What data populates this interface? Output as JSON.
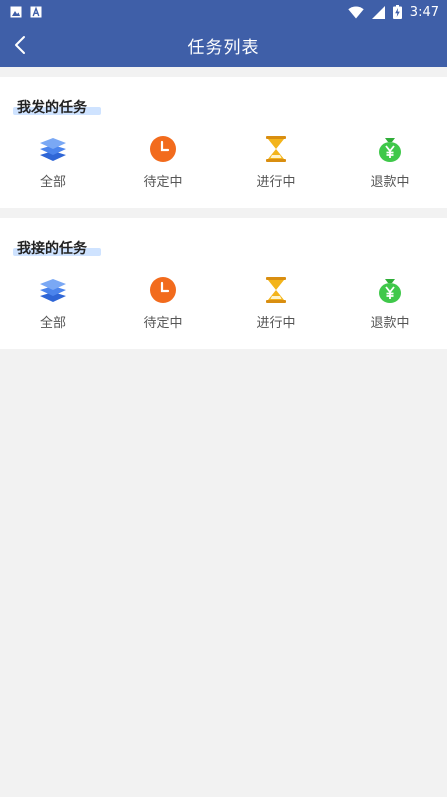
{
  "status_bar": {
    "time": "3:47",
    "icons": [
      "image-icon",
      "a-icon",
      "wifi-icon",
      "signal-icon",
      "battery-charging-icon"
    ]
  },
  "app_bar": {
    "title": "任务列表",
    "back_icon": "chevron-left-icon"
  },
  "colors": {
    "primary": "#3f5fa8",
    "blue_icon": "#3a7be8",
    "orange_icon": "#f26b1d",
    "gold_icon": "#f3b41a",
    "green_icon": "#3fc84a"
  },
  "sections": [
    {
      "title": "我发的任务",
      "items": [
        {
          "label": "全部",
          "icon": "layers-icon"
        },
        {
          "label": "待定中",
          "icon": "clock-icon"
        },
        {
          "label": "进行中",
          "icon": "hourglass-icon"
        },
        {
          "label": "退款中",
          "icon": "money-bag-icon"
        }
      ]
    },
    {
      "title": "我接的任务",
      "items": [
        {
          "label": "全部",
          "icon": "layers-icon"
        },
        {
          "label": "待定中",
          "icon": "clock-icon"
        },
        {
          "label": "进行中",
          "icon": "hourglass-icon"
        },
        {
          "label": "退款中",
          "icon": "money-bag-icon"
        }
      ]
    }
  ]
}
